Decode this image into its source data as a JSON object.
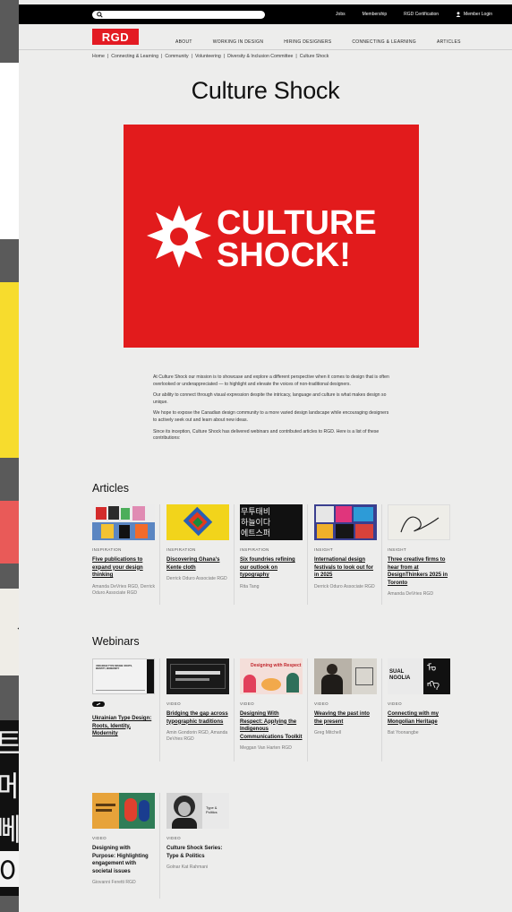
{
  "search": {
    "placeholder": ""
  },
  "topbar": {
    "links": [
      "Jobs",
      "Membership",
      "RGD Certification"
    ],
    "login": "Member Login"
  },
  "logo": {
    "text": "RGD"
  },
  "nav": [
    "ABOUT",
    "WORKING IN DESIGN",
    "HIRING DESIGNERS",
    "CONNECTING & LEARNING",
    "ARTICLES"
  ],
  "breadcrumb": [
    "Home",
    "Connecting & Learning",
    "Community",
    "Volunteering",
    "Diversity & Inclusion Committee",
    "Culture Shock"
  ],
  "title": "Culture Shock",
  "hero": {
    "line1": "CULTURE",
    "line2": "SHOCK!"
  },
  "intro": [
    "At Culture Shock our mission is to showcase and explore a different perspective when it comes to design that is often overlooked or underappreciated — to highlight and elevate the voices of non-traditional designers.",
    "Our ability to connect through visual expression despite the intricacy, language and culture is what makes design so unique.",
    "We hope to expose the Canadian design community to a more varied design landscape while encouraging designers to actively seek out and learn about new ideas.",
    "Since its inception, Culture Shock has delivered webinars and contributed articles to RGD. Here is a list of these contributions:"
  ],
  "articles": {
    "heading": "Articles",
    "items": [
      {
        "cat": "INSPIRATION",
        "title": "Five publications to expand your design thinking",
        "author": "Amanda DeVries RGD, Derrick Oduro Associate RGD"
      },
      {
        "cat": "INSPIRATION",
        "title": "Discovering Ghana's Kente cloth",
        "author": "Derrick Oduro Associate RGD"
      },
      {
        "cat": "INSPIRATION",
        "title": "Six foundries refining our outlook on typography",
        "author": "Rita Tang"
      },
      {
        "cat": "INSIGHT",
        "title": "International design festivals to look out for in 2025",
        "author": "Derrick Oduro Associate RGD"
      },
      {
        "cat": "INSIGHT",
        "title": "Three creative firms to hear from at DesignThinkers 2025 in Toronto",
        "author": "Amanda DeVries RGD"
      }
    ]
  },
  "webinars": {
    "heading": "Webinars",
    "items": [
      {
        "cat": "",
        "title": "Ukrainian Type Design: Roots, Identity, Modernity",
        "author": ""
      },
      {
        "cat": "VIDEO",
        "title": "Bridging the gap across typographic traditions",
        "author": "Amin Gondorin RGD, Amanda DeVries RGD"
      },
      {
        "cat": "VIDEO",
        "title": "Designing With Respect: Applying the Indigenous Communications Toolkit",
        "author": "Meggan Van Harten RGD"
      },
      {
        "cat": "VIDEO",
        "title": "Weaving the past into the present",
        "author": "Greg Mitchell"
      },
      {
        "cat": "VIDEO",
        "title": "Connecting with my Mongolian Heritage",
        "author": "Bat Yoonangbe"
      },
      {
        "cat": "VIDEO",
        "title": "Designing with Purpose: Highlighting engagement with societal issues",
        "author": "Giovanni Feretti RGD"
      },
      {
        "cat": "VIDEO",
        "title": "Culture Shock Series: Type & Politics",
        "author": "Golnar Kat Rahmani"
      }
    ],
    "thumb_texts": {
      "w0": "UKRAINIAN TYPE DESIGN: ROOTS, IDENTITY, MODERNITY",
      "w2": "Designing with Respect",
      "w4": "SUAL NGOLIA",
      "w6": "Type & Politics"
    }
  },
  "colors": {
    "brand_red": "#e31b23",
    "hero_red": "#e21b1c",
    "page_bg": "#ededec",
    "topbar": "#000000"
  }
}
